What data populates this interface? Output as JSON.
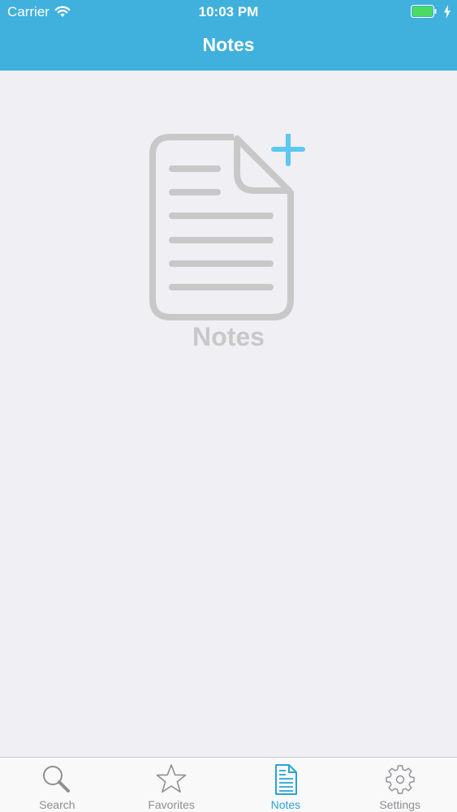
{
  "status_bar": {
    "carrier": "Carrier",
    "time": "10:03 PM",
    "battery_color": "#4cd964"
  },
  "nav": {
    "title": "Notes",
    "background": "#40b0dd"
  },
  "empty_state": {
    "icon": "add-note-icon",
    "label": "Notes",
    "icon_color": "#c8c8c8",
    "plus_color": "#5bc8ef"
  },
  "tab_bar": {
    "active_color": "#2aa3d6",
    "tabs": [
      {
        "label": "Search",
        "icon": "search-icon"
      },
      {
        "label": "Favorites",
        "icon": "star-icon"
      },
      {
        "label": "Notes",
        "icon": "notes-icon"
      },
      {
        "label": "Settings",
        "icon": "gear-icon"
      }
    ],
    "active_index": 2
  }
}
